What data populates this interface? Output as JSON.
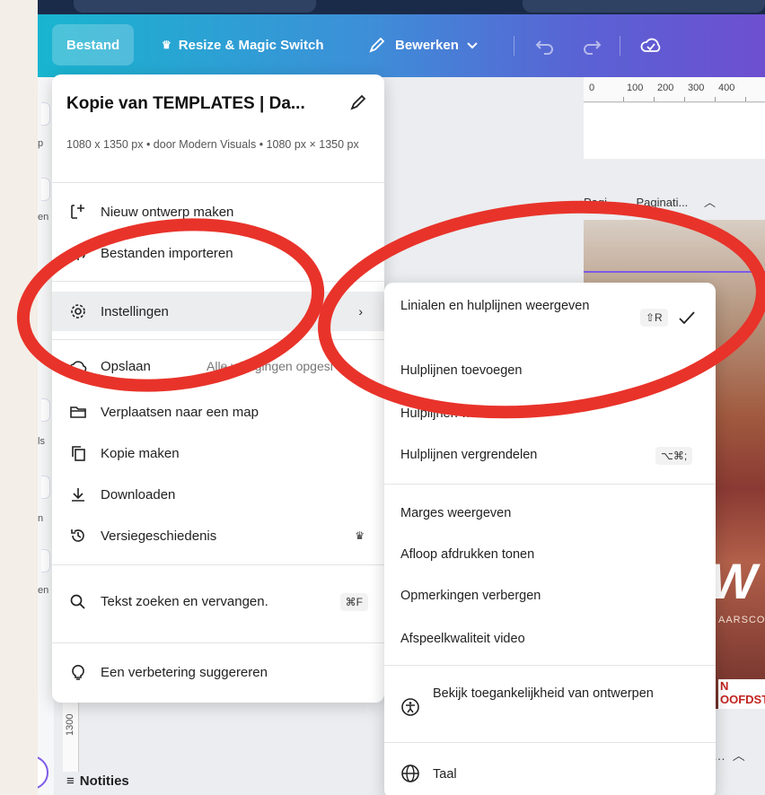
{
  "toolbar": {
    "file": "Bestand",
    "resize": "Resize & Magic Switch",
    "edit": "Bewerken"
  },
  "ruler": {
    "ticks": [
      "0",
      "100",
      "200",
      "300",
      "400"
    ]
  },
  "pages": {
    "label1": "Pagi...",
    "label2": "Paginati..."
  },
  "photo": {
    "big_text": "W",
    "small_text": "AARSCO",
    "red_text_1": "N",
    "red_text_2": "OOFDST"
  },
  "left_strip": {
    "labels": [
      "p",
      "en",
      "ls",
      "n",
      "en"
    ]
  },
  "vertical_ruler": "1300",
  "notes": "Notities",
  "menu": {
    "title": "Kopie van TEMPLATES | Da...",
    "subtitle": "1080 x 1350 px • door Modern Visuals • 1080 px × 1350 px",
    "items": [
      {
        "label": "Nieuw ontwerp maken",
        "icon": "new-design-icon"
      },
      {
        "label": "Bestanden importeren",
        "icon": "import-icon"
      },
      {
        "label": "Instellingen",
        "icon": "gear-icon"
      },
      {
        "label": "Opslaan",
        "icon": "cloud-check-icon",
        "extra": "Alle wijzigingen opgesl"
      },
      {
        "label": "Verplaatsen naar een map",
        "icon": "folder-icon"
      },
      {
        "label": "Kopie maken",
        "icon": "copy-icon"
      },
      {
        "label": "Downloaden",
        "icon": "download-icon"
      },
      {
        "label": "Versiegeschiedenis",
        "icon": "history-icon"
      },
      {
        "label": "Tekst zoeken en vervangen.",
        "icon": "search-icon",
        "shortcut": "⌘F"
      },
      {
        "label": "Een verbetering suggereren",
        "icon": "lightbulb-icon"
      }
    ]
  },
  "submenu": {
    "items": [
      {
        "label": "Linialen en hulplijnen weergeven",
        "shortcut": "⇧R",
        "checked": true
      },
      {
        "label": "Hulplijnen toevoegen"
      },
      {
        "label": "Hulplijnen wissen"
      },
      {
        "label": "Hulplijnen vergrendelen",
        "shortcut": "⌥⌘;"
      },
      {
        "label": "Marges weergeven"
      },
      {
        "label": "Afloop afdrukken tonen"
      },
      {
        "label": "Opmerkingen verbergen"
      },
      {
        "label": "Afspeelkwaliteit video"
      },
      {
        "label": "Bekijk toegankelijkheid van ontwerpen",
        "icon": "accessibility-icon"
      },
      {
        "label": "Taal",
        "icon": "globe-icon"
      }
    ]
  },
  "colors": {
    "annotation": "#e8332a",
    "toolbar_start": "#18b5cf",
    "toolbar_end": "#6d4fd0"
  }
}
